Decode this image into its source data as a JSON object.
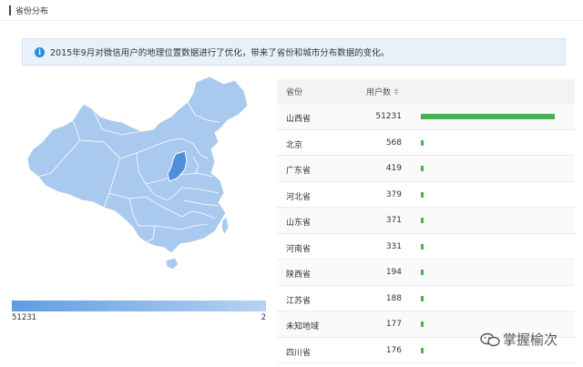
{
  "section": {
    "title": "省份分布"
  },
  "notice": {
    "message": "2015年9月对微信用户的地理位置数据进行了优化，带来了省份和城市分布数据的变化。"
  },
  "legend": {
    "max": "51231",
    "min": "2"
  },
  "table": {
    "col_province": "省份",
    "col_users": "用户数",
    "max_value": 51231,
    "rows": [
      {
        "province": "山西省",
        "users": "51231",
        "value": 51231
      },
      {
        "province": "北京",
        "users": "568",
        "value": 568
      },
      {
        "province": "广东省",
        "users": "419",
        "value": 419
      },
      {
        "province": "河北省",
        "users": "379",
        "value": 379
      },
      {
        "province": "山东省",
        "users": "371",
        "value": 371
      },
      {
        "province": "河南省",
        "users": "331",
        "value": 331
      },
      {
        "province": "陕西省",
        "users": "194",
        "value": 194
      },
      {
        "province": "江苏省",
        "users": "188",
        "value": 188
      },
      {
        "province": "未知地域",
        "users": "177",
        "value": 177
      },
      {
        "province": "四川省",
        "users": "176",
        "value": 176
      }
    ]
  },
  "colors": {
    "bar": "#4caf50",
    "map_base": "#a9c9ef",
    "map_highlight": "#4f8fd9",
    "info": "#2b8bd6"
  },
  "watermark": {
    "text": "掌握榆次"
  }
}
